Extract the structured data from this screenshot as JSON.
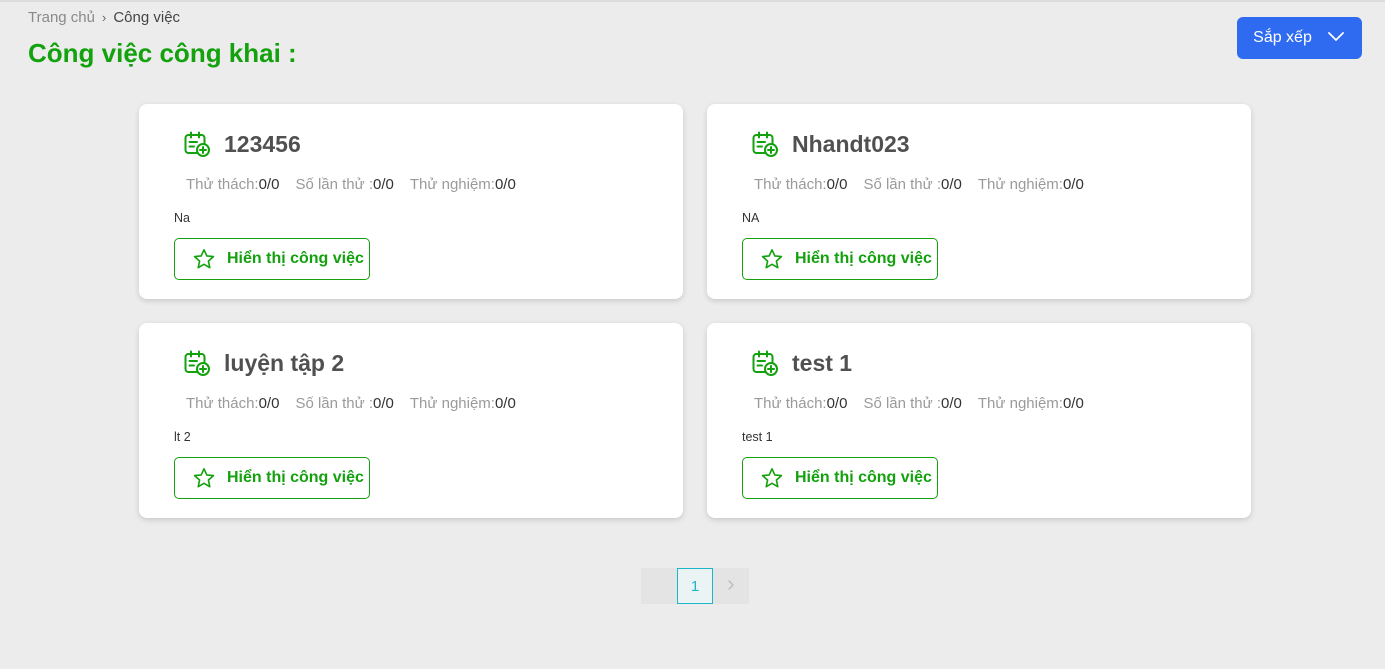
{
  "breadcrumb": {
    "home": "Trang chủ",
    "current": "Công việc"
  },
  "page_title": "Công việc công khai :",
  "sort_button": {
    "label": "Sắp xếp"
  },
  "labels": {
    "challenge": "Thử thách:",
    "attempts": "Số lần thử :",
    "test": "Thử nghiệm:",
    "view_button": "Hiển thị công việc"
  },
  "cards": [
    {
      "title": "123456",
      "challenge": "0/0",
      "attempts": "0/0",
      "test": "0/0",
      "description": "Na"
    },
    {
      "title": "Nhandt023",
      "challenge": "0/0",
      "attempts": "0/0",
      "test": "0/0",
      "description": "NA"
    },
    {
      "title": "luyện tập 2",
      "challenge": "0/0",
      "attempts": "0/0",
      "test": "0/0",
      "description": "lt 2"
    },
    {
      "title": "test 1",
      "challenge": "0/0",
      "attempts": "0/0",
      "test": "0/0",
      "description": "test 1"
    }
  ],
  "pagination": {
    "current_page": "1"
  },
  "icons": {
    "card": "calendar-add-icon",
    "view": "star-outline-icon",
    "sort": "chevron-down-icon",
    "next": "chevron-right-icon"
  },
  "colors": {
    "accent_green": "#13a10e",
    "primary_blue": "#2f6bf0",
    "page_active": "#1cb5c9"
  }
}
